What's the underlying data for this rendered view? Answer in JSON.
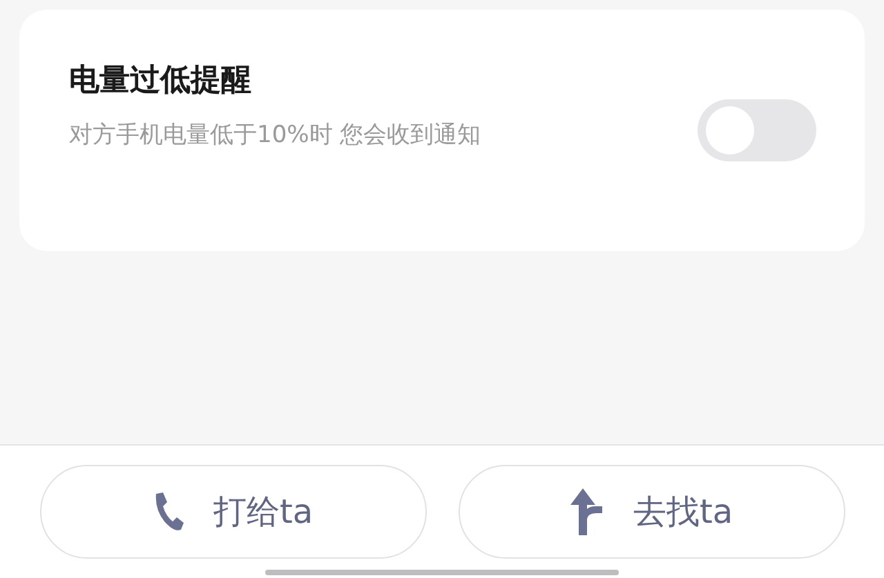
{
  "setting": {
    "title": "电量过低提醒",
    "description": "对方手机电量低于10%时 您会收到通知",
    "on": false
  },
  "buttons": [
    {
      "kind": "call",
      "label": "打给ta"
    },
    {
      "kind": "navigate",
      "label": "去找ta"
    }
  ]
}
